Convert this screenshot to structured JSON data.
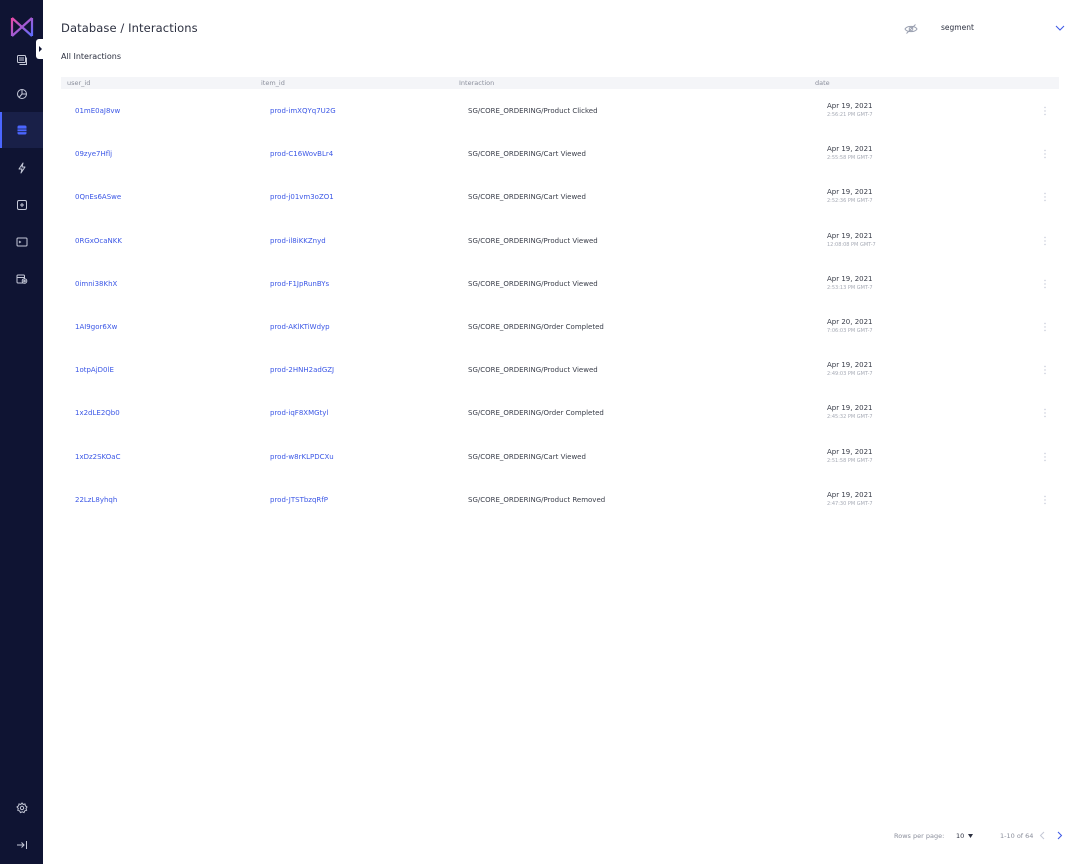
{
  "header": {
    "title": "Database / Interactions",
    "dataset_select": "segment"
  },
  "section": {
    "title": "All Interactions"
  },
  "table": {
    "columns": [
      "user_id",
      "item_id",
      "Interaction",
      "date"
    ],
    "rows": [
      {
        "user_id": "01mE0aJ8vw",
        "item_id": "prod-imXQYq7U2G",
        "interaction": "SG/CORE_ORDERING/Product Clicked",
        "date": "Apr 19, 2021",
        "time": "2:56:21 PM GMT-7"
      },
      {
        "user_id": "09zye7Hflj",
        "item_id": "prod-C16WovBLr4",
        "interaction": "SG/CORE_ORDERING/Cart Viewed",
        "date": "Apr 19, 2021",
        "time": "2:55:58 PM GMT-7"
      },
      {
        "user_id": "0QnEs6ASwe",
        "item_id": "prod-j01vm3oZO1",
        "interaction": "SG/CORE_ORDERING/Cart Viewed",
        "date": "Apr 19, 2021",
        "time": "2:52:36 PM GMT-7"
      },
      {
        "user_id": "0RGxOcaNKK",
        "item_id": "prod-il8iKKZnyd",
        "interaction": "SG/CORE_ORDERING/Product Viewed",
        "date": "Apr 19, 2021",
        "time": "12:08:08 PM GMT-7"
      },
      {
        "user_id": "0imni38KhX",
        "item_id": "prod-F1JpRunBYs",
        "interaction": "SG/CORE_ORDERING/Product Viewed",
        "date": "Apr 19, 2021",
        "time": "2:53:13 PM GMT-7"
      },
      {
        "user_id": "1AI9gor6Xw",
        "item_id": "prod-AKlKTiWdyp",
        "interaction": "SG/CORE_ORDERING/Order Completed",
        "date": "Apr 20, 2021",
        "time": "7:06:03 PM GMT-7"
      },
      {
        "user_id": "1otpAjD0lE",
        "item_id": "prod-2HNH2adGZJ",
        "interaction": "SG/CORE_ORDERING/Product Viewed",
        "date": "Apr 19, 2021",
        "time": "2:49:03 PM GMT-7"
      },
      {
        "user_id": "1x2dLE2Qb0",
        "item_id": "prod-iqF8XMGtyl",
        "interaction": "SG/CORE_ORDERING/Order Completed",
        "date": "Apr 19, 2021",
        "time": "2:45:32 PM GMT-7"
      },
      {
        "user_id": "1xDz2SKOaC",
        "item_id": "prod-w8rKLPDCXu",
        "interaction": "SG/CORE_ORDERING/Cart Viewed",
        "date": "Apr 19, 2021",
        "time": "2:51:58 PM GMT-7"
      },
      {
        "user_id": "22LzL8yhqh",
        "item_id": "prod-JTSTbzqRfP",
        "interaction": "SG/CORE_ORDERING/Product Removed",
        "date": "Apr 19, 2021",
        "time": "2:47:30 PM GMT-7"
      }
    ]
  },
  "pagination": {
    "rows_per_page_label": "Rows per page:",
    "rows_per_page": "10",
    "range": "1-10 of 64"
  },
  "colors": {
    "sidebar": "#0f1433",
    "accent": "#3b57e6",
    "logo_gradient": [
      "#e94aa6",
      "#5b6cff"
    ]
  },
  "icons": {
    "sidebar": [
      "database-icon",
      "chart-pie-icon",
      "table-icon",
      "bolt-icon",
      "plus-square-icon",
      "terminal-icon",
      "calendar-settings-icon",
      "gear-icon",
      "logout-icon"
    ],
    "header": [
      "eye-icon",
      "chevron-down-icon"
    ],
    "row": "kebab-icon"
  }
}
